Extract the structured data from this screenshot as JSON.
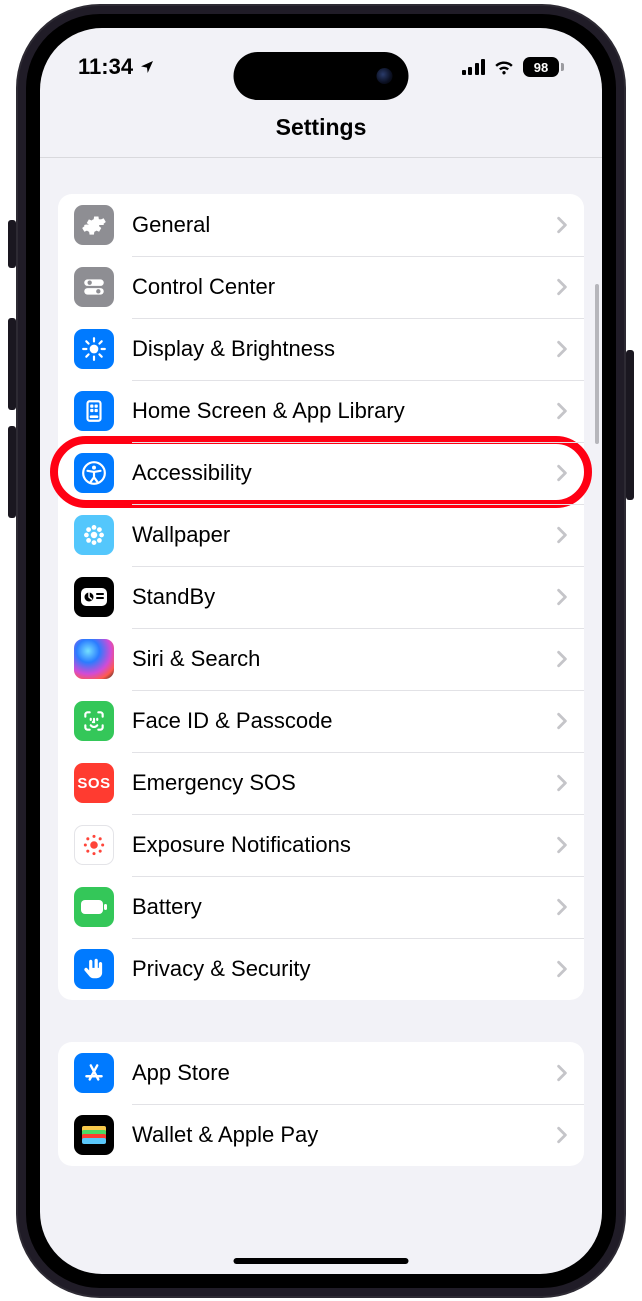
{
  "status": {
    "time": "11:34",
    "battery": "98"
  },
  "nav": {
    "title": "Settings"
  },
  "groups": [
    {
      "rows": [
        {
          "id": "general",
          "label": "General",
          "icon": "gear-icon",
          "iconClass": "ic-gray"
        },
        {
          "id": "control-center",
          "label": "Control Center",
          "icon": "control-center-icon",
          "iconClass": "ic-gray2"
        },
        {
          "id": "display-brightness",
          "label": "Display & Brightness",
          "icon": "brightness-icon",
          "iconClass": "ic-blue"
        },
        {
          "id": "home-screen",
          "label": "Home Screen & App Library",
          "icon": "home-screen-icon",
          "iconClass": "ic-blue"
        },
        {
          "id": "accessibility",
          "label": "Accessibility",
          "icon": "accessibility-icon",
          "iconClass": "ic-blue",
          "highlighted": true
        },
        {
          "id": "wallpaper",
          "label": "Wallpaper",
          "icon": "wallpaper-icon",
          "iconClass": "ic-cyan"
        },
        {
          "id": "standby",
          "label": "StandBy",
          "icon": "standby-icon",
          "iconClass": "ic-black"
        },
        {
          "id": "siri-search",
          "label": "Siri & Search",
          "icon": "siri-icon",
          "iconClass": "ic-siri"
        },
        {
          "id": "face-id",
          "label": "Face ID & Passcode",
          "icon": "face-id-icon",
          "iconClass": "ic-faceid"
        },
        {
          "id": "emergency-sos",
          "label": "Emergency SOS",
          "icon": "sos-icon",
          "iconClass": "ic-red"
        },
        {
          "id": "exposure",
          "label": "Exposure Notifications",
          "icon": "exposure-icon",
          "iconClass": "ic-white"
        },
        {
          "id": "battery",
          "label": "Battery",
          "icon": "battery-icon",
          "iconClass": "ic-green"
        },
        {
          "id": "privacy-security",
          "label": "Privacy & Security",
          "icon": "hand-icon",
          "iconClass": "ic-blue"
        }
      ]
    },
    {
      "rows": [
        {
          "id": "app-store",
          "label": "App Store",
          "icon": "app-store-icon",
          "iconClass": "ic-blue"
        },
        {
          "id": "wallet",
          "label": "Wallet & Apple Pay",
          "icon": "wallet-icon",
          "iconClass": "ic-wallet"
        }
      ]
    }
  ],
  "annotation": {
    "highlight_color": "#ff0013"
  }
}
